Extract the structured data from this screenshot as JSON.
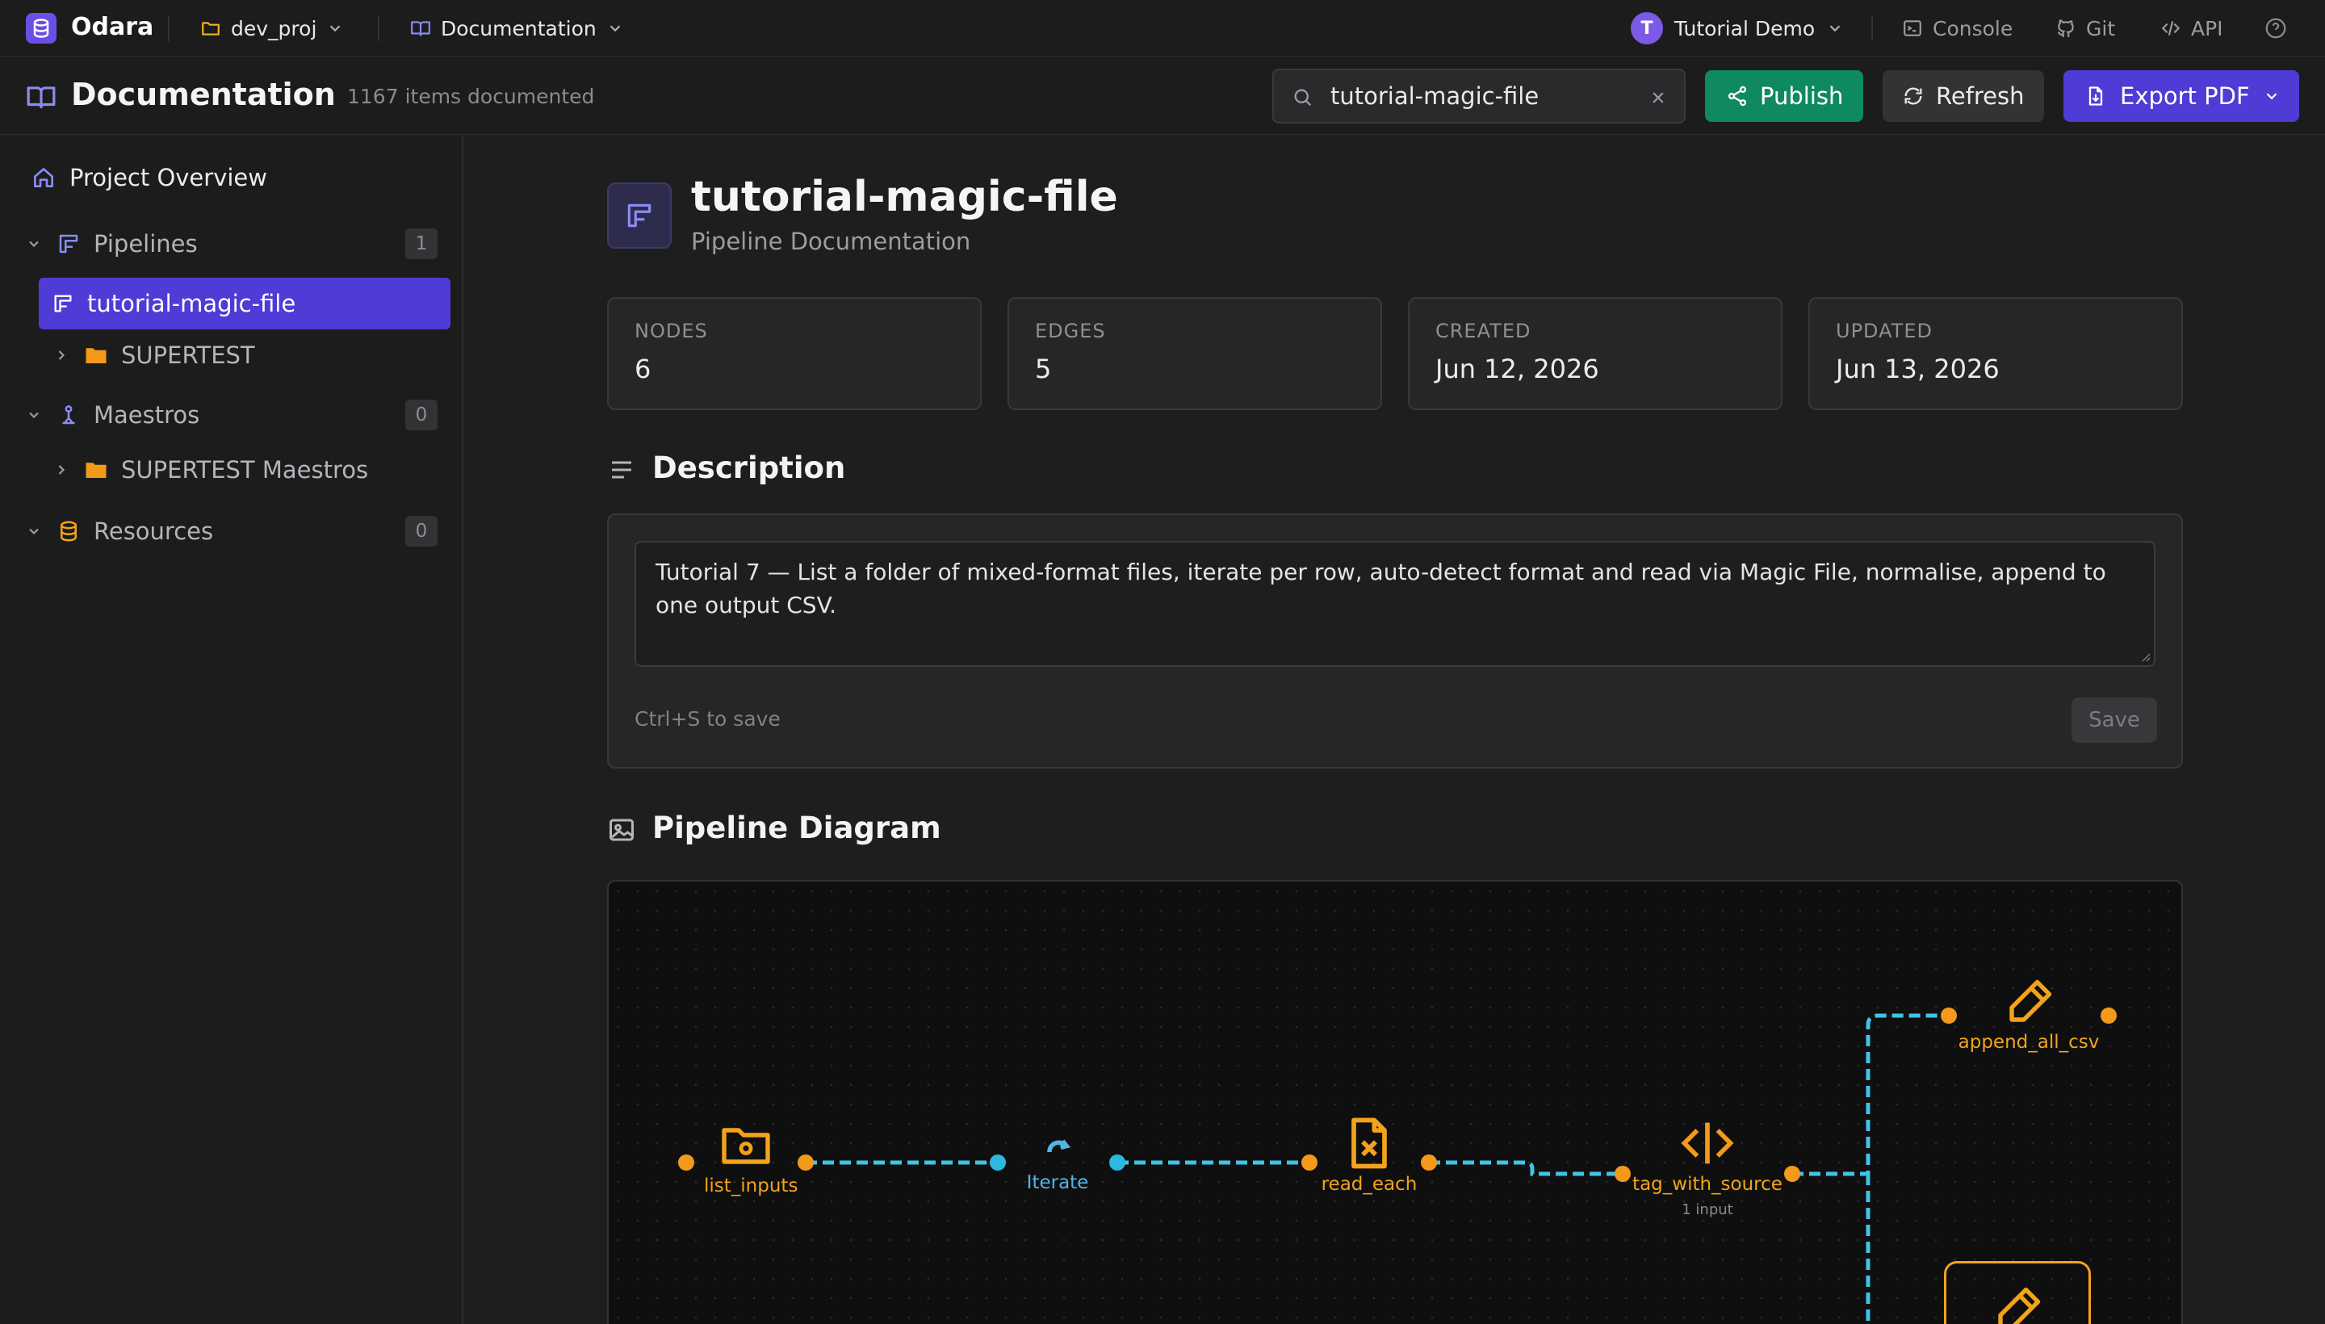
{
  "app": {
    "name": "Odara",
    "project": "dev_proj",
    "section": "Documentation"
  },
  "topbar": {
    "user_initial": "T",
    "user_name": "Tutorial Demo",
    "console": "Console",
    "git": "Git",
    "api": "API"
  },
  "header": {
    "title": "Documentation",
    "subtitle": "1167 items documented",
    "search_value": "tutorial-magic-file",
    "publish": "Publish",
    "refresh": "Refresh",
    "export": "Export PDF"
  },
  "sidebar": {
    "overview": "Project Overview",
    "pipelines": {
      "label": "Pipelines",
      "count": "1"
    },
    "active_item": "tutorial-magic-file",
    "folder1": "SUPERTEST",
    "maestros": {
      "label": "Maestros",
      "count": "0"
    },
    "folder2": "SUPERTEST Maestros",
    "resources": {
      "label": "Resources",
      "count": "0"
    }
  },
  "page": {
    "title": "tutorial-magic-file",
    "subtitle": "Pipeline Documentation",
    "stats": [
      {
        "label": "NODES",
        "value": "6"
      },
      {
        "label": "EDGES",
        "value": "5"
      },
      {
        "label": "CREATED",
        "value": "Jun 12, 2026"
      },
      {
        "label": "UPDATED",
        "value": "Jun 13, 2026"
      }
    ],
    "description_heading": "Description",
    "description_line1": "Tutorial 7 — List a folder of mixed-format files, iterate per row, auto-detect format and read via Magic File, normalise, append to",
    "description_line2": "one output CSV.",
    "save_hint": "Ctrl+S to save",
    "save": "Save",
    "diagram_heading": "Pipeline Diagram"
  },
  "diagram": {
    "nodes": {
      "list_inputs": "list_inputs",
      "iterate": "Iterate",
      "read_each": "read_each",
      "tag_with_source": "tag_with_source",
      "tag_sub": "1 input",
      "append_all_csv": "append_all_csv"
    }
  },
  "colors": {
    "accent": "#4f3bd6",
    "publish": "#0f8a5f",
    "node": "#f3a31b",
    "edge": "#3fc4e6",
    "iterate": "#55b4e6"
  }
}
